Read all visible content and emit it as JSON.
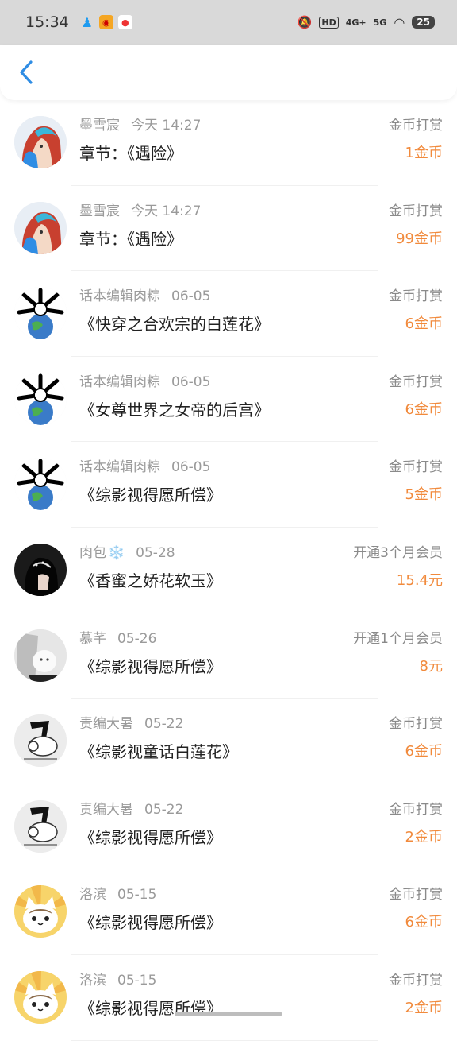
{
  "status_bar": {
    "time": "15:34",
    "battery": "25",
    "net_4g": "4G+",
    "net_5g": "5G",
    "hd": "HD"
  },
  "colors": {
    "amount": "#f18a3c",
    "back": "#2f8de4"
  },
  "items": [
    {
      "name": "墨雪宸",
      "time": "今天 14:27",
      "content": "章节：《遇险》",
      "type": "金币打赏",
      "amount": "1金币",
      "avatar": "anime-girl"
    },
    {
      "name": "墨雪宸",
      "time": "今天 14:27",
      "content": "章节：《遇险》",
      "type": "金币打赏",
      "amount": "99金币",
      "avatar": "anime-girl"
    },
    {
      "name": "话本编辑肉粽",
      "time": "06-05",
      "content": "《快穿之合欢宗的白莲花》",
      "type": "金币打赏",
      "amount": "6金币",
      "avatar": "cartoon-earth"
    },
    {
      "name": "话本编辑肉粽",
      "time": "06-05",
      "content": "《女尊世界之女帝的后宫》",
      "type": "金币打赏",
      "amount": "6金币",
      "avatar": "cartoon-earth"
    },
    {
      "name": "话本编辑肉粽",
      "time": "06-05",
      "content": "《综影视得愿所偿》",
      "type": "金币打赏",
      "amount": "5金币",
      "avatar": "cartoon-earth"
    },
    {
      "name": "肉包",
      "time": "05-28",
      "content": "《香蜜之娇花软玉》",
      "type": "开通3个月会员",
      "amount": "15.4元",
      "avatar": "dark-girl",
      "snow": "❄️"
    },
    {
      "name": "慕芊",
      "time": "05-26",
      "content": "《综影视得愿所偿》",
      "type": "开通1个月会员",
      "amount": "8元",
      "avatar": "gray-photo"
    },
    {
      "name": "责编大暑",
      "time": "05-22",
      "content": "《综影视童话白莲花》",
      "type": "金币打赏",
      "amount": "6金币",
      "avatar": "sketch-cat"
    },
    {
      "name": "责编大暑",
      "time": "05-22",
      "content": "《综影视得愿所偿》",
      "type": "金币打赏",
      "amount": "2金币",
      "avatar": "sketch-cat"
    },
    {
      "name": "洛滨",
      "time": "05-15",
      "content": "《综影视得愿所偿》",
      "type": "金币打赏",
      "amount": "6金币",
      "avatar": "chi-cat"
    },
    {
      "name": "洛滨",
      "time": "05-15",
      "content": "《综影视得愿所偿》",
      "type": "金币打赏",
      "amount": "2金币",
      "avatar": "chi-cat"
    }
  ]
}
